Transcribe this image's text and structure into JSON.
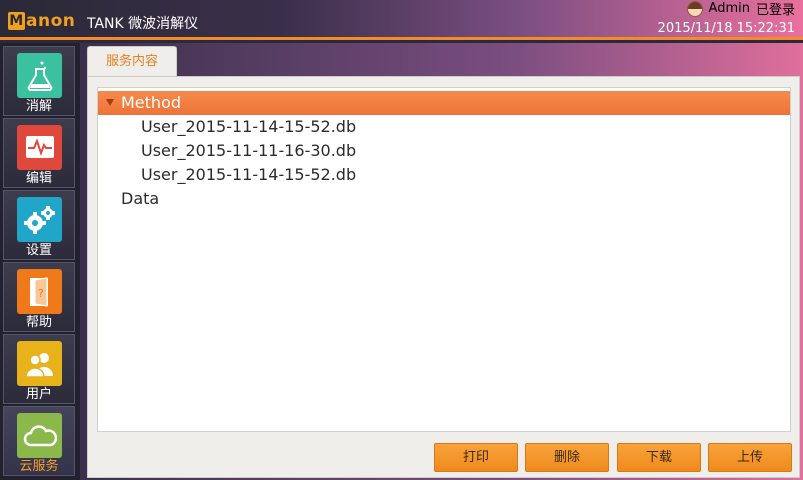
{
  "header": {
    "logo_text": "anon",
    "logo_mark": "M",
    "app_title": "TANK 微波消解仪",
    "user_name": "Admin",
    "login_status": "已登录",
    "datetime": "2015/11/18 15:22:31"
  },
  "sidebar": {
    "items": [
      {
        "label": "消解",
        "icon": "flask-icon",
        "color": "#3cc1a0"
      },
      {
        "label": "编辑",
        "icon": "chart-edit-icon",
        "color": "#e0483c"
      },
      {
        "label": "设置",
        "icon": "gears-icon",
        "color": "#1fa6c8"
      },
      {
        "label": "帮助",
        "icon": "help-door-icon",
        "color": "#f07a1a"
      },
      {
        "label": "用户",
        "icon": "users-icon",
        "color": "#e7b21a"
      },
      {
        "label": "云服务",
        "icon": "cloud-icon",
        "color": "#8bb84a"
      }
    ]
  },
  "main": {
    "tab_label": "服务内容",
    "tree": [
      {
        "label": "Method",
        "expanded": true,
        "selected": true
      },
      {
        "label": "User_2015-11-14-15-52.db"
      },
      {
        "label": "User_2015-11-11-16-30.db"
      },
      {
        "label": "User_2015-11-14-15-52.db"
      },
      {
        "label": "Data"
      }
    ],
    "buttons": {
      "print": "打印",
      "delete": "删除",
      "download": "下载",
      "upload": "上传"
    }
  },
  "colors": {
    "accent": "#f28c28",
    "selection": "#ef7338"
  }
}
